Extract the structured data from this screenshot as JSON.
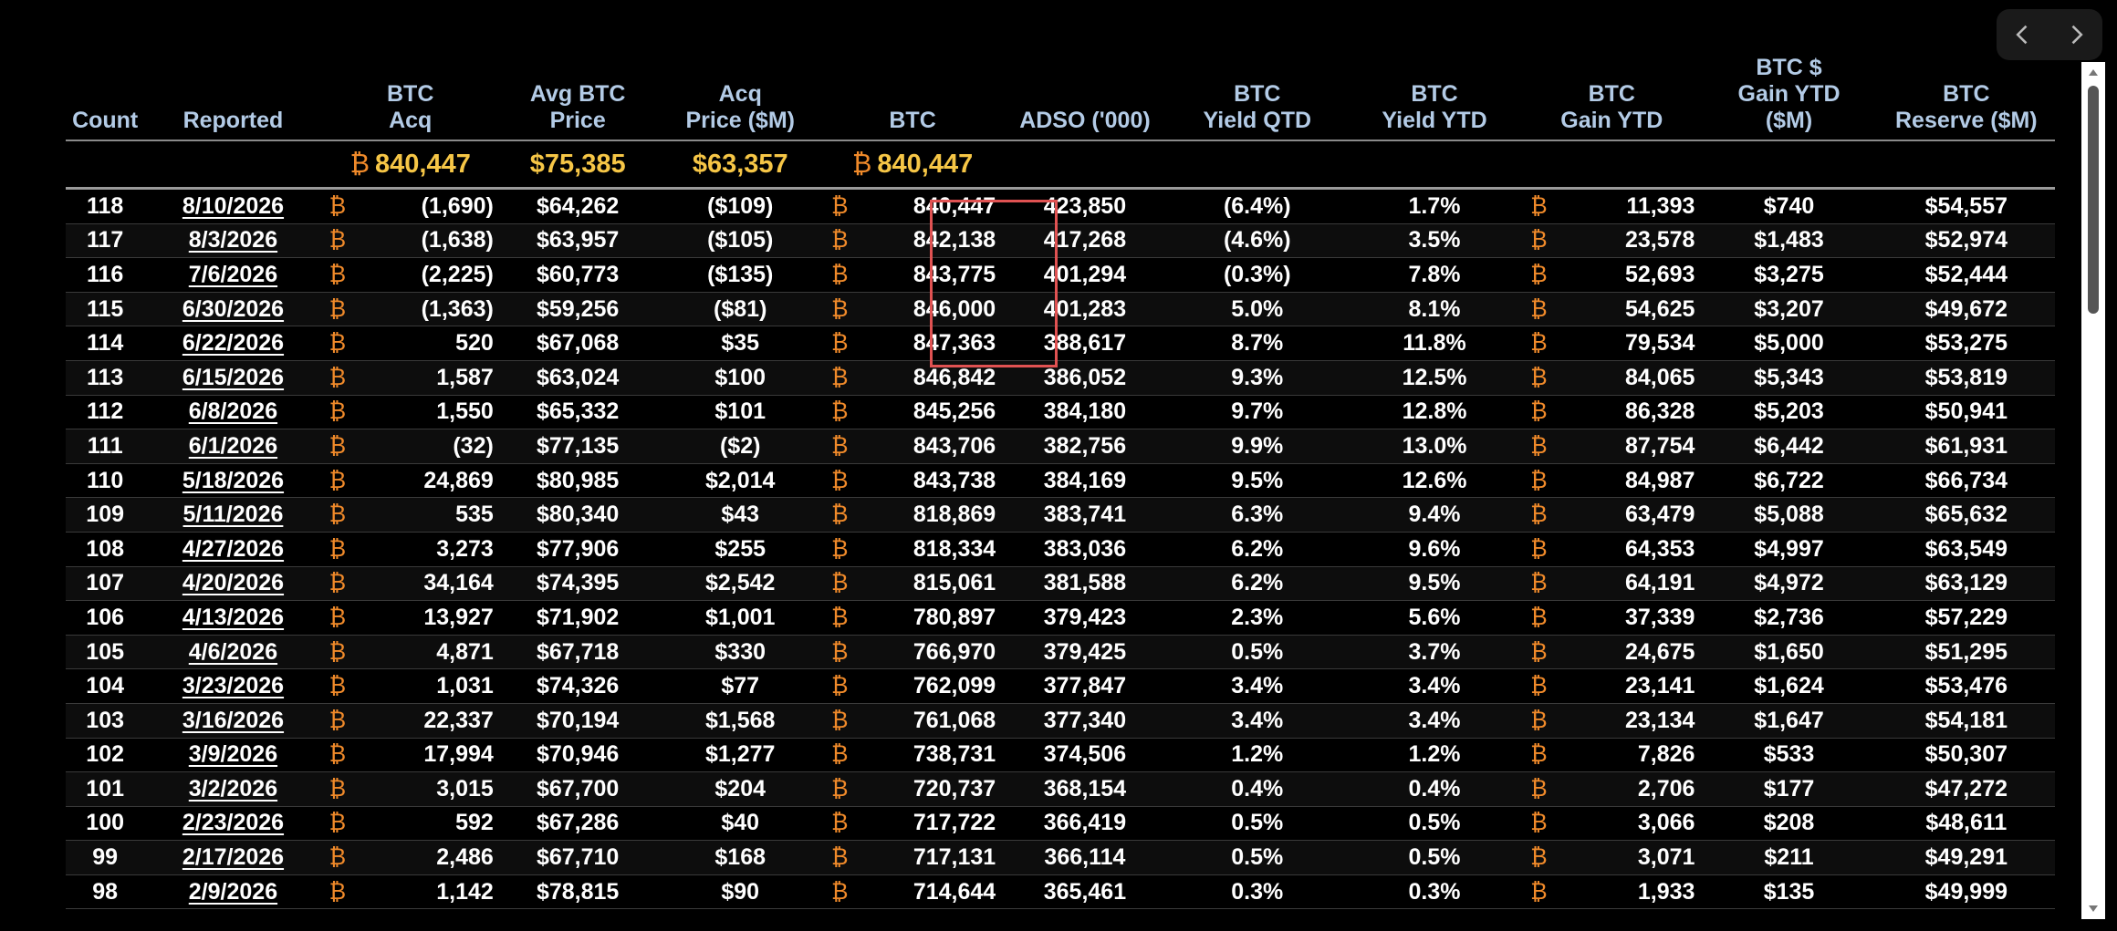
{
  "nav": {
    "prev_icon": "chevron-left-icon",
    "next_icon": "chevron-right-icon"
  },
  "btc_symbol": "₿",
  "colors": {
    "accent": "#f6c646",
    "symbol": "#f08a2a",
    "header": "#b3cbe6",
    "highlight": "#e05252"
  },
  "headers": [
    "Count",
    "Reported",
    "BTC\nAcq",
    "Avg BTC\nPrice",
    "Acq\nPrice ($M)",
    "BTC",
    "ADSO ('000)",
    "BTC\nYield QTD",
    "BTC\nYield YTD",
    "BTC\nGain YTD",
    "BTC $\nGain YTD\n($M)",
    "BTC\nReserve ($M)"
  ],
  "totals": {
    "btc_acq": "840,447",
    "avg_price": "$75,385",
    "acq_price": "$63,357",
    "btc": "840,447"
  },
  "rows": [
    [
      "118",
      "8/10/2026",
      "(1,690)",
      "$64,262",
      "($109)",
      "840,447",
      "423,850",
      "(6.4%)",
      "1.7%",
      "11,393",
      "$740",
      "$54,557"
    ],
    [
      "117",
      "8/3/2026",
      "(1,638)",
      "$63,957",
      "($105)",
      "842,138",
      "417,268",
      "(4.6%)",
      "3.5%",
      "23,578",
      "$1,483",
      "$52,974"
    ],
    [
      "116",
      "7/6/2026",
      "(2,225)",
      "$60,773",
      "($135)",
      "843,775",
      "401,294",
      "(0.3%)",
      "7.8%",
      "52,693",
      "$3,275",
      "$52,444"
    ],
    [
      "115",
      "6/30/2026",
      "(1,363)",
      "$59,256",
      "($81)",
      "846,000",
      "401,283",
      "5.0%",
      "8.1%",
      "54,625",
      "$3,207",
      "$49,672"
    ],
    [
      "114",
      "6/22/2026",
      "520",
      "$67,068",
      "$35",
      "847,363",
      "388,617",
      "8.7%",
      "11.8%",
      "79,534",
      "$5,000",
      "$53,275"
    ],
    [
      "113",
      "6/15/2026",
      "1,587",
      "$63,024",
      "$100",
      "846,842",
      "386,052",
      "9.3%",
      "12.5%",
      "84,065",
      "$5,343",
      "$53,819"
    ],
    [
      "112",
      "6/8/2026",
      "1,550",
      "$65,332",
      "$101",
      "845,256",
      "384,180",
      "9.7%",
      "12.8%",
      "86,328",
      "$5,203",
      "$50,941"
    ],
    [
      "111",
      "6/1/2026",
      "(32)",
      "$77,135",
      "($2)",
      "843,706",
      "382,756",
      "9.9%",
      "13.0%",
      "87,754",
      "$6,442",
      "$61,931"
    ],
    [
      "110",
      "5/18/2026",
      "24,869",
      "$80,985",
      "$2,014",
      "843,738",
      "384,169",
      "9.5%",
      "12.6%",
      "84,987",
      "$6,722",
      "$66,734"
    ],
    [
      "109",
      "5/11/2026",
      "535",
      "$80,340",
      "$43",
      "818,869",
      "383,741",
      "6.3%",
      "9.4%",
      "63,479",
      "$5,088",
      "$65,632"
    ],
    [
      "108",
      "4/27/2026",
      "3,273",
      "$77,906",
      "$255",
      "818,334",
      "383,036",
      "6.2%",
      "9.6%",
      "64,353",
      "$4,997",
      "$63,549"
    ],
    [
      "107",
      "4/20/2026",
      "34,164",
      "$74,395",
      "$2,542",
      "815,061",
      "381,588",
      "6.2%",
      "9.5%",
      "64,191",
      "$4,972",
      "$63,129"
    ],
    [
      "106",
      "4/13/2026",
      "13,927",
      "$71,902",
      "$1,001",
      "780,897",
      "379,423",
      "2.3%",
      "5.6%",
      "37,339",
      "$2,736",
      "$57,229"
    ],
    [
      "105",
      "4/6/2026",
      "4,871",
      "$67,718",
      "$330",
      "766,970",
      "379,425",
      "0.5%",
      "3.7%",
      "24,675",
      "$1,650",
      "$51,295"
    ],
    [
      "104",
      "3/23/2026",
      "1,031",
      "$74,326",
      "$77",
      "762,099",
      "377,847",
      "3.4%",
      "3.4%",
      "23,141",
      "$1,624",
      "$53,476"
    ],
    [
      "103",
      "3/16/2026",
      "22,337",
      "$70,194",
      "$1,568",
      "761,068",
      "377,340",
      "3.4%",
      "3.4%",
      "23,134",
      "$1,647",
      "$54,181"
    ],
    [
      "102",
      "3/9/2026",
      "17,994",
      "$70,946",
      "$1,277",
      "738,731",
      "374,506",
      "1.2%",
      "1.2%",
      "7,826",
      "$533",
      "$50,307"
    ],
    [
      "101",
      "3/2/2026",
      "3,015",
      "$67,700",
      "$204",
      "720,737",
      "368,154",
      "0.4%",
      "0.4%",
      "2,706",
      "$177",
      "$47,272"
    ],
    [
      "100",
      "2/23/2026",
      "592",
      "$67,286",
      "$40",
      "717,722",
      "366,419",
      "0.5%",
      "0.5%",
      "3,066",
      "$208",
      "$48,611"
    ],
    [
      "99",
      "2/17/2026",
      "2,486",
      "$67,710",
      "$168",
      "717,131",
      "366,114",
      "0.5%",
      "0.5%",
      "3,071",
      "$211",
      "$49,291"
    ],
    [
      "98",
      "2/9/2026",
      "1,142",
      "$78,815",
      "$90",
      "714,644",
      "365,461",
      "0.3%",
      "0.3%",
      "1,933",
      "$135",
      "$49,999"
    ]
  ]
}
